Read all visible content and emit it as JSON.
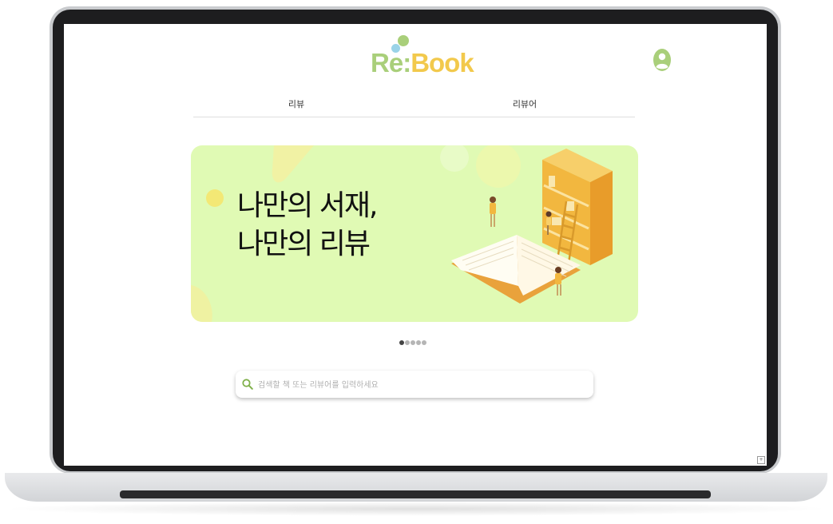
{
  "app": {
    "logo_re": "Re",
    "logo_colon": ":",
    "logo_book": "Book",
    "brand_green": "#a9cf7a",
    "brand_yellow": "#f2c94c"
  },
  "header": {
    "profile_icon": "user-circle-icon"
  },
  "nav": {
    "tabs": [
      {
        "label": "리뷰"
      },
      {
        "label": "리뷰어"
      }
    ]
  },
  "banner": {
    "line1": "나만의 서재,",
    "line2": "나만의 리뷰",
    "background": "#e0fab4"
  },
  "carousel": {
    "total_slides": 5,
    "active_index": 0
  },
  "search": {
    "placeholder": "검색할 책 또는 리뷰어를 입력하세요",
    "value": ""
  }
}
